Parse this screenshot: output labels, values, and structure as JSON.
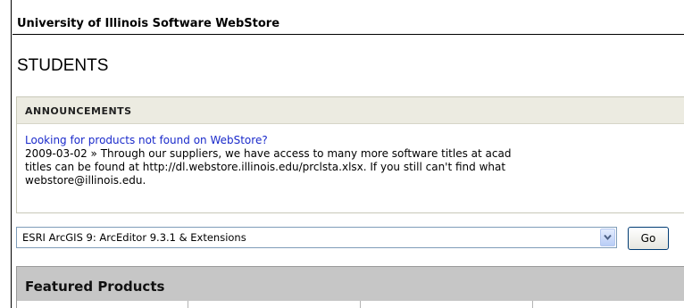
{
  "store": {
    "title": "University of Illinois Software WebStore"
  },
  "section": {
    "heading": "STUDENTS"
  },
  "announcements": {
    "header": "ANNOUNCEMENTS",
    "link_text": "Looking for products not found on WebStore?",
    "lines": [
      "2009-03-02 » Through our suppliers, we have access to many more software titles at acad",
      "titles can be found at http://dl.webstore.illinois.edu/prclsta.xlsx. If you still can't find what",
      "webstore@illinois.edu."
    ]
  },
  "product_picker": {
    "selected": "ESRI ArcGIS 9: ArcEditor 9.3.1 & Extensions",
    "go_label": "Go"
  },
  "featured": {
    "title": "Featured Products"
  },
  "colors": {
    "link": "#1a2acb",
    "announce_header_bg": "#ecebe1",
    "featured_header_bg": "#c6c6c6"
  }
}
